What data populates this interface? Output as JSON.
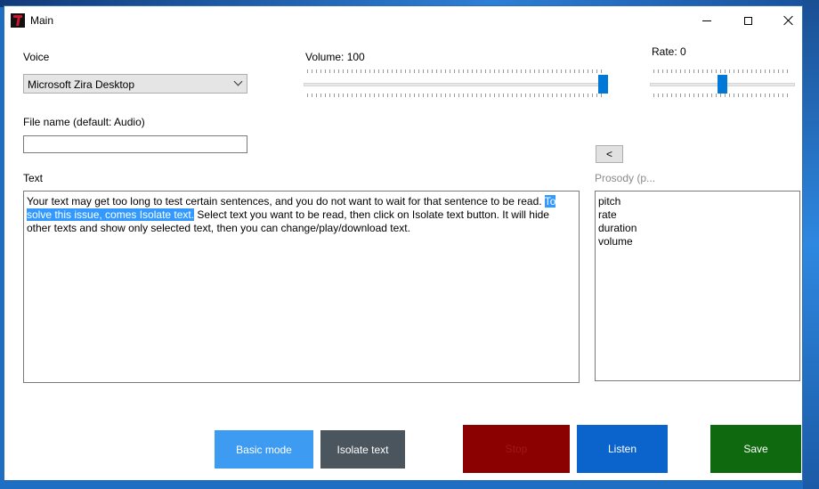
{
  "window": {
    "title": "Main"
  },
  "voice": {
    "label": "Voice",
    "selected": "Microsoft Zira Desktop"
  },
  "volume": {
    "label": "Volume: 100",
    "value": 100
  },
  "rate": {
    "label": "Rate: 0",
    "value": 0
  },
  "file_name": {
    "label": "File name (default: Audio)",
    "value": ""
  },
  "back_button": {
    "label": "<"
  },
  "text": {
    "label": "Text",
    "before_selection": "Your text may get too long to test certain sentences, and you do not want to wait for that sentence to be read. ",
    "selection_line1": "To",
    "selection_line2": "solve this issue, comes Isolate text.",
    "after_selection_line2": " Select text you want to be read, then click on Isolate text button. It will hide",
    "line3": "other texts and show only selected text, then you can change/play/download text."
  },
  "prosody": {
    "label": "Prosody (p...",
    "items": [
      "pitch",
      "rate",
      "duration",
      "volume"
    ]
  },
  "buttons": {
    "basic_mode": "Basic mode",
    "isolate_text": "Isolate text",
    "stop": "Stop",
    "listen": "Listen",
    "save": "Save"
  },
  "colors": {
    "accent": "#0078d7",
    "selection": "#3399ff",
    "basic_mode": "#3d9bf2",
    "isolate_text": "#4a555d",
    "stop": "#8b0000",
    "listen": "#0a64cc",
    "save": "#0f6a0f"
  }
}
